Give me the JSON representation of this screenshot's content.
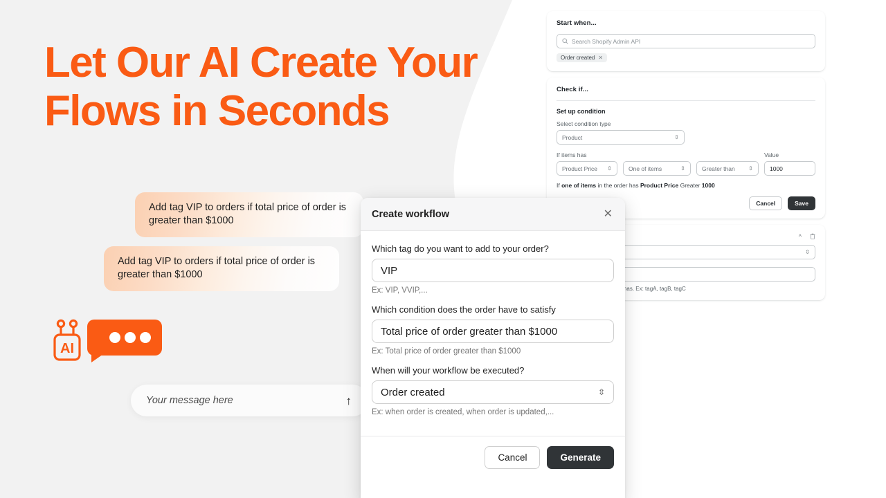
{
  "headline": "Let Our AI Create Your\nFlows in Seconds",
  "brand_color": "#FA5B14",
  "chat": {
    "bubbles": [
      {
        "text": "Add tag VIP to orders if total price of order is greater than $1000"
      },
      {
        "text": "Add tag VIP to orders if total price of order is greater than $1000"
      }
    ],
    "logo_label": "AI",
    "input": {
      "placeholder": "Your message here",
      "send_icon": "send-arrow-up-icon"
    }
  },
  "builder": {
    "trigger_card": {
      "title": "Start when...",
      "search_placeholder": "Search Shopify Admin API",
      "search_icon": "search-icon",
      "chip": "Order created",
      "chip_remove_icon": "close-icon"
    },
    "condition_card": {
      "title": "Check if...",
      "section_title": "Set up condition",
      "select_condition_label": "Select condition type",
      "condition_type_value": "Product",
      "if_items_has_label": "If items has",
      "value_label": "Value",
      "field_value": "Product Price",
      "operator_scope_value": "One of items",
      "operator_value": "Greater than",
      "value_input": "1000",
      "summary_prefix": "If ",
      "summary_scope": "one of items",
      "summary_mid": " in the order has ",
      "summary_field": "Product Price",
      "summary_op": " Greater ",
      "summary_value": "1000",
      "cancel_label": "Cancel",
      "save_label": "Save"
    },
    "action_card": {
      "collapse_icon": "chevron-up-icon",
      "delete_icon": "trash-icon",
      "hint": "and separate them by commas. Ex: tagA, tagB, tagC"
    }
  },
  "modal": {
    "title": "Create workflow",
    "close_icon": "close-icon",
    "fields": [
      {
        "label": "Which tag do you want to add to your order?",
        "value": "VIP",
        "help": "Ex: VIP, VVIP,...",
        "type": "text"
      },
      {
        "label": "Which condition does the order have to satisfy",
        "value": "Total price of order greater than $1000",
        "help": "Ex: Total price of order greater than $1000",
        "type": "text"
      },
      {
        "label": "When will your workflow be executed?",
        "value": "Order created",
        "help": "Ex: when order is created, when order is updated,...",
        "type": "select"
      }
    ],
    "cancel_label": "Cancel",
    "generate_label": "Generate"
  }
}
